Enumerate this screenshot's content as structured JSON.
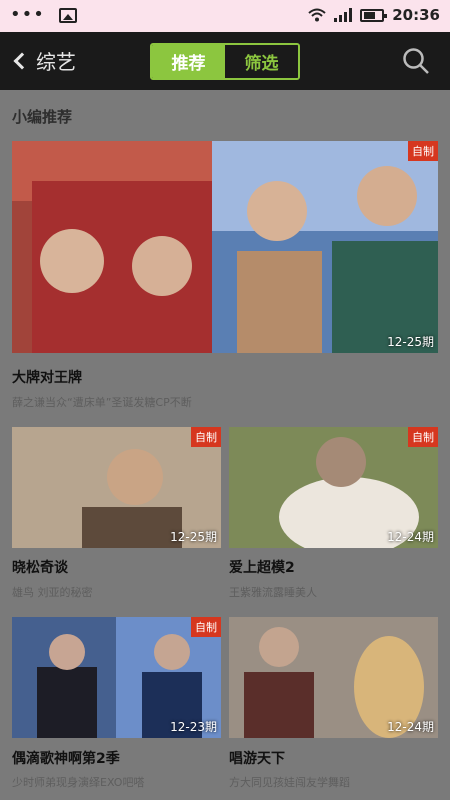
{
  "status_bar": {
    "time": "20:36"
  },
  "nav": {
    "back_label": "综艺",
    "tabs": [
      {
        "label": "推荐"
      },
      {
        "label": "筛选"
      }
    ]
  },
  "section_title": "小编推荐",
  "featured": {
    "badge": "自制",
    "episode": "12-25期",
    "title": "大牌对王牌",
    "desc": "薛之谦当众“遭床单”圣诞发糖CP不断"
  },
  "grid": [
    {
      "badge": "自制",
      "episode": "12-25期",
      "title": "晓松奇谈",
      "desc": "雄鸟 刘亚的秘密"
    },
    {
      "badge": "自制",
      "episode": "12-24期",
      "title": "爱上超模2",
      "desc": "王紫雅流露睡美人"
    },
    {
      "badge": "自制",
      "episode": "12-23期",
      "title": "偶滴歌神啊第2季",
      "desc": "少时师弟现身演绎EXO吧嗒"
    },
    {
      "badge": "",
      "episode": "12-24期",
      "title": "唱游天下",
      "desc": "方大同见孩娃闯友学舞蹈"
    }
  ]
}
